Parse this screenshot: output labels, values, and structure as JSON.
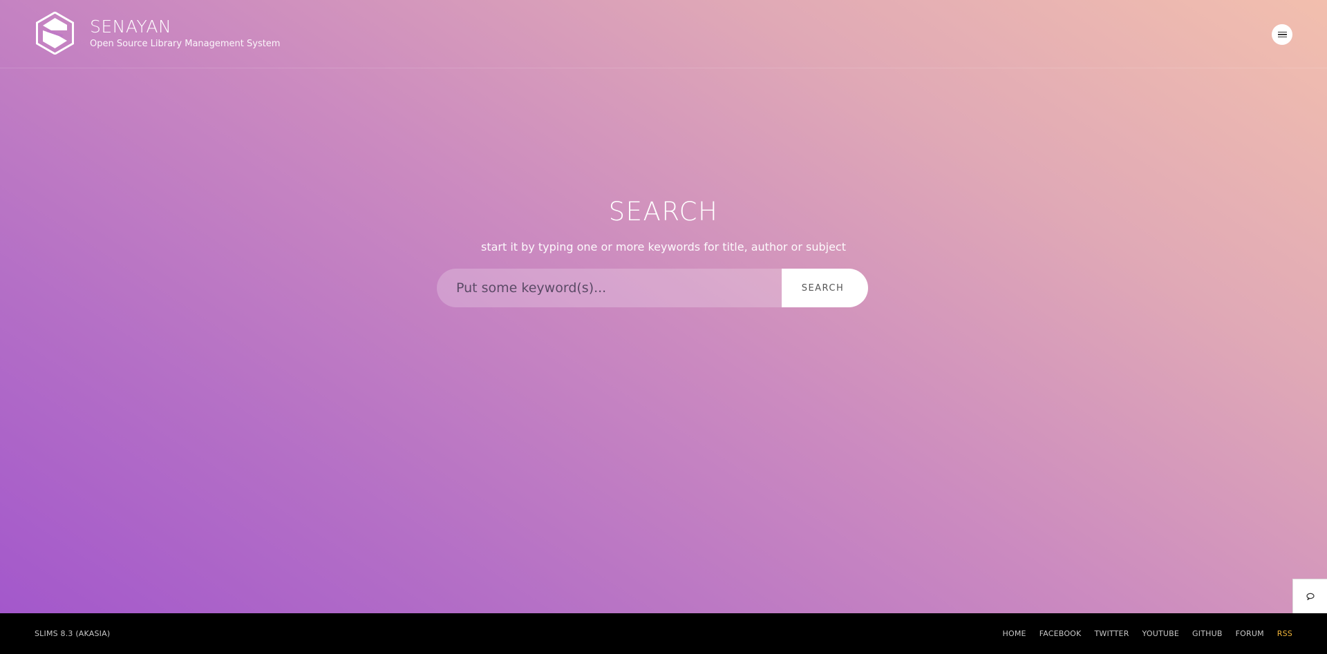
{
  "header": {
    "title": "SENAYAN",
    "subtitle": "Open Source Library Management System",
    "logo_icon": "hexagon-s-logo",
    "menu_icon": "hamburger-icon"
  },
  "search": {
    "heading": "SEARCH",
    "subheading": "start it by typing one or more keywords for title, author or subject",
    "placeholder": "Put some keyword(s)...",
    "button_label": "SEARCH"
  },
  "chat": {
    "icon": "chat-bubble-icon"
  },
  "footer": {
    "version": "SLIMS 8.3 (AKASIA)",
    "links": [
      "HOME",
      "FACEBOOK",
      "TWITTER",
      "YOUTUBE",
      "GITHUB",
      "FORUM",
      "RSS"
    ]
  },
  "colors": {
    "gradient_start": "#a155cc",
    "gradient_end": "#f2bfae",
    "footer_bg": "#000000",
    "rss_accent": "#f3b73a"
  }
}
